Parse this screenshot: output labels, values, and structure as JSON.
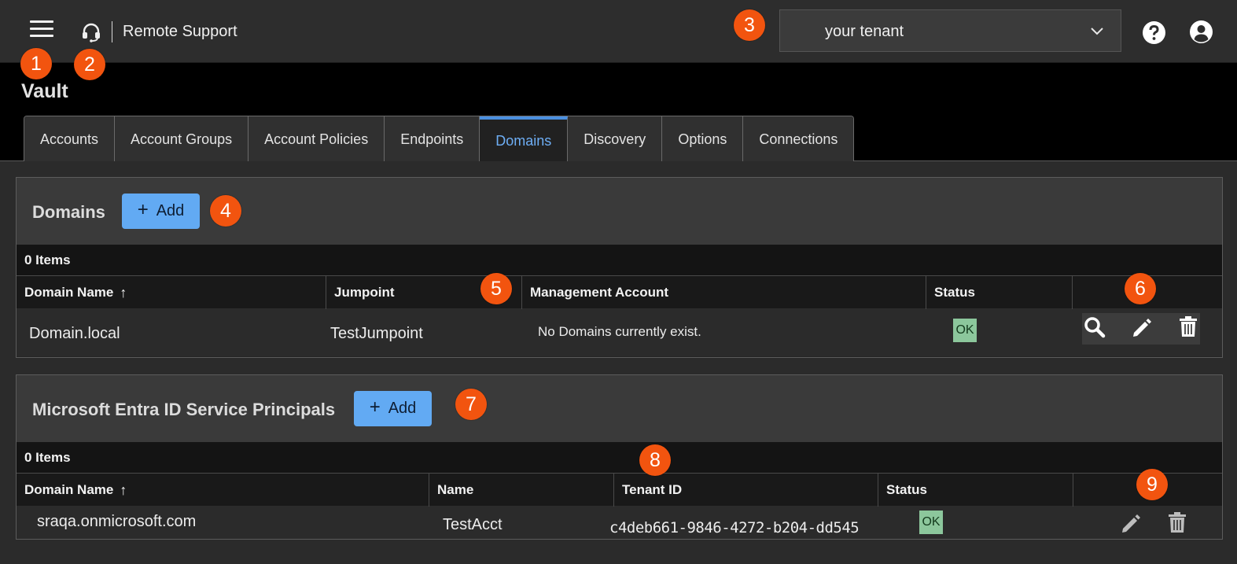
{
  "header": {
    "app_name": "Remote Support",
    "tenant_selected": "your tenant"
  },
  "page": {
    "title": "Vault"
  },
  "tabs": [
    {
      "label": "Accounts",
      "active": false
    },
    {
      "label": "Account Groups",
      "active": false
    },
    {
      "label": "Account Policies",
      "active": false
    },
    {
      "label": "Endpoints",
      "active": false
    },
    {
      "label": "Domains",
      "active": true
    },
    {
      "label": "Discovery",
      "active": false
    },
    {
      "label": "Options",
      "active": false
    },
    {
      "label": "Connections",
      "active": false
    }
  ],
  "domains": {
    "title": "Domains",
    "add_label": "Add",
    "count": "0 Items",
    "columns": [
      "Domain Name",
      "Jumpoint",
      "Management Account",
      "Status",
      ""
    ],
    "sort_indicator": "↑",
    "row": {
      "domain_name": "Domain.local",
      "jumpoint": "TestJumpoint",
      "management_account": "No Domains currently exist.",
      "status": "OK"
    }
  },
  "entra": {
    "title": "Microsoft Entra ID Service Principals",
    "add_label": "Add",
    "count": "0 Items",
    "columns": [
      "Domain Name",
      "Name",
      "Tenant ID",
      "Status",
      ""
    ],
    "sort_indicator": "↑",
    "row": {
      "domain_name": "sraqa.onmicrosoft.com",
      "name": "TestAcct",
      "tenant_id": "c4deb661-9846-4272-b204-dd545",
      "status": "OK"
    }
  },
  "callouts": [
    "1",
    "2",
    "3",
    "4",
    "5",
    "6",
    "7",
    "8",
    "9"
  ],
  "colors": {
    "accent_blue": "#62aaf3",
    "active_tab_text": "#6eaef5",
    "callout_orange": "#f2540f",
    "ok_badge": "#8cc79c"
  },
  "icons": [
    "menu-icon",
    "headset-icon",
    "chevron-down-icon",
    "help-icon",
    "user-icon",
    "search-icon",
    "edit-icon",
    "trash-icon"
  ]
}
